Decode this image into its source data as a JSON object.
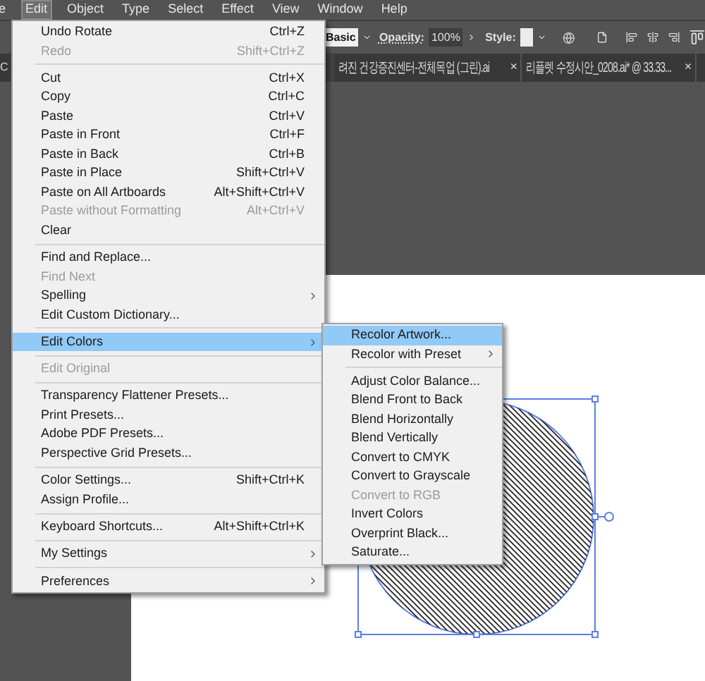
{
  "menubar": [
    {
      "label": "e",
      "selected": false
    },
    {
      "label": "Edit",
      "selected": true
    },
    {
      "label": "Object",
      "selected": false
    },
    {
      "label": "Type",
      "selected": false
    },
    {
      "label": "Select",
      "selected": false
    },
    {
      "label": "Effect",
      "selected": false
    },
    {
      "label": "View",
      "selected": false
    },
    {
      "label": "Window",
      "selected": false
    },
    {
      "label": "Help",
      "selected": false
    }
  ],
  "control_bar": {
    "brush": "Basic",
    "opacity_label": "Opacity:",
    "opacity": "100%",
    "style_label": "Style:"
  },
  "tabs": [
    {
      "label": "C"
    },
    {
      "label": "려진 건강증진센터-전체목업 (그린).ai",
      "close": "×"
    },
    {
      "label": "리플렛 수정시안_0208.ai* @ 33.33...",
      "close": "×"
    }
  ],
  "edit_menu": {
    "groups": [
      {
        "items": [
          {
            "label": "Undo Rotate",
            "shortcut": "Ctrl+Z",
            "disabled": false,
            "submenu": false,
            "selected": false
          },
          {
            "label": "Redo",
            "shortcut": "Shift+Ctrl+Z",
            "disabled": true,
            "submenu": false,
            "selected": false
          }
        ]
      },
      {
        "items": [
          {
            "label": "Cut",
            "shortcut": "Ctrl+X",
            "disabled": false,
            "submenu": false,
            "selected": false
          },
          {
            "label": "Copy",
            "shortcut": "Ctrl+C",
            "disabled": false,
            "submenu": false,
            "selected": false
          },
          {
            "label": "Paste",
            "shortcut": "Ctrl+V",
            "disabled": false,
            "submenu": false,
            "selected": false
          },
          {
            "label": "Paste in Front",
            "shortcut": "Ctrl+F",
            "disabled": false,
            "submenu": false,
            "selected": false
          },
          {
            "label": "Paste in Back",
            "shortcut": "Ctrl+B",
            "disabled": false,
            "submenu": false,
            "selected": false
          },
          {
            "label": "Paste in Place",
            "shortcut": "Shift+Ctrl+V",
            "disabled": false,
            "submenu": false,
            "selected": false
          },
          {
            "label": "Paste on All Artboards",
            "shortcut": "Alt+Shift+Ctrl+V",
            "disabled": false,
            "submenu": false,
            "selected": false
          },
          {
            "label": "Paste without Formatting",
            "shortcut": "Alt+Ctrl+V",
            "disabled": true,
            "submenu": false,
            "selected": false
          },
          {
            "label": "Clear",
            "disabled": false,
            "submenu": false,
            "selected": false
          }
        ]
      },
      {
        "items": [
          {
            "label": "Find and Replace...",
            "disabled": false,
            "submenu": false,
            "selected": false
          },
          {
            "label": "Find Next",
            "disabled": true,
            "submenu": false,
            "selected": false
          },
          {
            "label": "Spelling",
            "disabled": false,
            "submenu": true,
            "selected": false
          },
          {
            "label": "Edit Custom Dictionary...",
            "disabled": false,
            "submenu": false,
            "selected": false
          }
        ]
      },
      {
        "items": [
          {
            "label": "Edit Colors",
            "disabled": false,
            "submenu": true,
            "selected": true
          }
        ]
      },
      {
        "items": [
          {
            "label": "Edit Original",
            "disabled": true,
            "submenu": false,
            "selected": false
          }
        ]
      },
      {
        "items": [
          {
            "label": "Transparency Flattener Presets...",
            "disabled": false,
            "submenu": false,
            "selected": false
          },
          {
            "label": "Print Presets...",
            "disabled": false,
            "submenu": false,
            "selected": false
          },
          {
            "label": "Adobe PDF Presets...",
            "disabled": false,
            "submenu": false,
            "selected": false
          },
          {
            "label": "Perspective Grid Presets...",
            "disabled": false,
            "submenu": false,
            "selected": false
          }
        ]
      },
      {
        "items": [
          {
            "label": "Color Settings...",
            "shortcut": "Shift+Ctrl+K",
            "disabled": false,
            "submenu": false,
            "selected": false
          },
          {
            "label": "Assign Profile...",
            "disabled": false,
            "submenu": false,
            "selected": false
          }
        ]
      },
      {
        "items": [
          {
            "label": "Keyboard Shortcuts...",
            "shortcut": "Alt+Shift+Ctrl+K",
            "disabled": false,
            "submenu": false,
            "selected": false
          }
        ]
      },
      {
        "items": [
          {
            "label": "My Settings",
            "disabled": false,
            "submenu": true,
            "selected": false
          }
        ]
      },
      {
        "items": [
          {
            "label": "Preferences",
            "disabled": false,
            "submenu": true,
            "selected": false
          }
        ]
      }
    ]
  },
  "edit_colors_submenu": {
    "groups": [
      {
        "items": [
          {
            "label": "Recolor Artwork...",
            "disabled": false,
            "submenu": false,
            "selected": true
          },
          {
            "label": "Recolor with Preset",
            "disabled": false,
            "submenu": true,
            "selected": false
          }
        ]
      },
      {
        "items": [
          {
            "label": "Adjust Color Balance...",
            "disabled": false,
            "submenu": false,
            "selected": false
          },
          {
            "label": "Blend Front to Back",
            "disabled": false,
            "submenu": false,
            "selected": false
          },
          {
            "label": "Blend Horizontally",
            "disabled": false,
            "submenu": false,
            "selected": false
          },
          {
            "label": "Blend Vertically",
            "disabled": false,
            "submenu": false,
            "selected": false
          },
          {
            "label": "Convert to CMYK",
            "disabled": false,
            "submenu": false,
            "selected": false
          },
          {
            "label": "Convert to Grayscale",
            "disabled": false,
            "submenu": false,
            "selected": false
          },
          {
            "label": "Convert to RGB",
            "disabled": true,
            "submenu": false,
            "selected": false
          },
          {
            "label": "Invert Colors",
            "disabled": false,
            "submenu": false,
            "selected": false
          },
          {
            "label": "Overprint Black...",
            "disabled": false,
            "submenu": false,
            "selected": false
          },
          {
            "label": "Saturate...",
            "disabled": false,
            "submenu": false,
            "selected": false
          }
        ]
      }
    ]
  }
}
